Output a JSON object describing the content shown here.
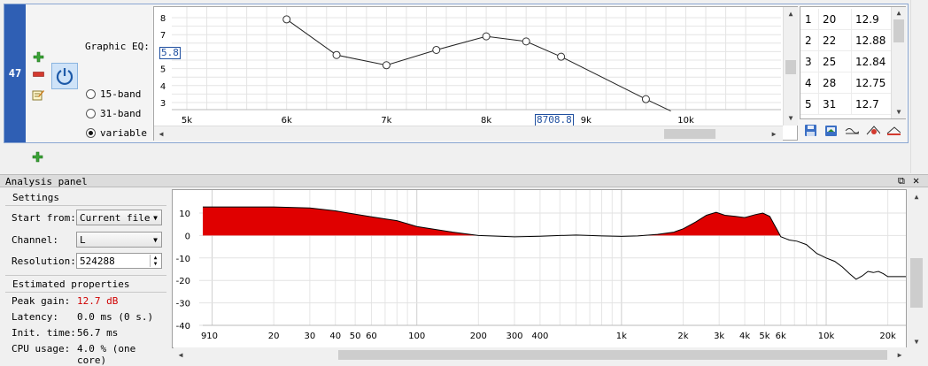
{
  "filter": {
    "index": "47",
    "graphic_eq_label": "Graphic EQ:",
    "eq_value_box": "5.8",
    "freq_value_box": "8708.8",
    "modes": [
      {
        "label": "15-band",
        "selected": false
      },
      {
        "label": "31-band",
        "selected": false
      },
      {
        "label": "variable",
        "selected": true
      }
    ],
    "y_ticks": [
      "8",
      "7",
      "6",
      "5",
      "4",
      "3"
    ],
    "x_ticks": [
      "5k",
      "6k",
      "7k",
      "8k",
      "9k",
      "10k"
    ],
    "eq_curve": [
      {
        "freq": 6000,
        "gain": 7.9
      },
      {
        "freq": 6500,
        "gain": 5.8
      },
      {
        "freq": 7000,
        "gain": 5.2
      },
      {
        "freq": 7500,
        "gain": 6.1
      },
      {
        "freq": 8000,
        "gain": 6.9
      },
      {
        "freq": 8400,
        "gain": 6.6
      },
      {
        "freq": 8750,
        "gain": 5.7
      },
      {
        "freq": 9600,
        "gain": 3.2
      },
      {
        "freq": 9850,
        "gain": 2.5
      }
    ],
    "table": [
      {
        "n": "1",
        "freq": "20",
        "gain": "12.9"
      },
      {
        "n": "2",
        "freq": "22",
        "gain": "12.88"
      },
      {
        "n": "3",
        "freq": "25",
        "gain": "12.84"
      },
      {
        "n": "4",
        "freq": "28",
        "gain": "12.75"
      },
      {
        "n": "5",
        "freq": "31",
        "gain": "12.7"
      }
    ],
    "colors": {
      "accent": "#2f5fb4",
      "add": "#3aa336",
      "remove": "#d33a2f"
    }
  },
  "analysis": {
    "title": "Analysis panel",
    "settings_heading": "Settings",
    "start_from_label": "Start from:",
    "start_from_value": "Current file",
    "channel_label": "Channel:",
    "channel_value": "L",
    "resolution_label": "Resolution:",
    "resolution_value": "524288",
    "estimated_heading": "Estimated properties",
    "peak_gain_label": "Peak gain:",
    "peak_gain_value": "12.7 dB",
    "latency_label": "Latency:",
    "latency_value": "0.0 ms (0 s.)",
    "init_time_label": "Init. time:",
    "init_time_value": "56.7 ms",
    "cpu_label": "CPU usage:",
    "cpu_value": "4.0 % (one core)",
    "peak_color": "#d00000"
  },
  "chart_data": {
    "type": "area",
    "title": "",
    "xlabel": "",
    "ylabel": "",
    "x_scale": "log",
    "xlim": [
      9,
      25000
    ],
    "ylim": [
      -40,
      15
    ],
    "y_ticks": [
      10,
      0,
      -10,
      -20,
      -30,
      -40
    ],
    "x_ticks": [
      {
        "v": 9,
        "label": "9"
      },
      {
        "v": 10,
        "label": "10"
      },
      {
        "v": 20,
        "label": "20"
      },
      {
        "v": 30,
        "label": "30"
      },
      {
        "v": 40,
        "label": "40"
      },
      {
        "v": 50,
        "label": "50"
      },
      {
        "v": 60,
        "label": "60"
      },
      {
        "v": 100,
        "label": "100"
      },
      {
        "v": 200,
        "label": "200"
      },
      {
        "v": 300,
        "label": "300"
      },
      {
        "v": 400,
        "label": "400"
      },
      {
        "v": 1000,
        "label": "1k"
      },
      {
        "v": 2000,
        "label": "2k"
      },
      {
        "v": 3000,
        "label": "3k"
      },
      {
        "v": 4000,
        "label": "4k"
      },
      {
        "v": 5000,
        "label": "5k"
      },
      {
        "v": 6000,
        "label": "6k"
      },
      {
        "v": 10000,
        "label": "10k"
      },
      {
        "v": 20000,
        "label": "20k"
      }
    ],
    "fill_color": "#e00000",
    "points": [
      [
        9,
        12.7
      ],
      [
        10,
        12.7
      ],
      [
        20,
        12.7
      ],
      [
        30,
        12.3
      ],
      [
        40,
        11.0
      ],
      [
        50,
        9.5
      ],
      [
        60,
        8.3
      ],
      [
        70,
        7.4
      ],
      [
        80,
        6.6
      ],
      [
        100,
        4.0
      ],
      [
        150,
        1.5
      ],
      [
        200,
        0.0
      ],
      [
        300,
        -0.6
      ],
      [
        400,
        -0.3
      ],
      [
        500,
        0.0
      ],
      [
        600,
        0.2
      ],
      [
        700,
        0.0
      ],
      [
        800,
        -0.2
      ],
      [
        1000,
        -0.4
      ],
      [
        1200,
        -0.2
      ],
      [
        1500,
        0.5
      ],
      [
        1800,
        1.5
      ],
      [
        2000,
        3.0
      ],
      [
        2300,
        6.0
      ],
      [
        2600,
        9.0
      ],
      [
        2900,
        10.3
      ],
      [
        3200,
        9.0
      ],
      [
        3600,
        8.5
      ],
      [
        4000,
        8.0
      ],
      [
        4500,
        9.3
      ],
      [
        4900,
        10.0
      ],
      [
        5300,
        8.5
      ],
      [
        5800,
        2.0
      ],
      [
        6000,
        -0.5
      ],
      [
        6600,
        -2.0
      ],
      [
        7200,
        -2.5
      ],
      [
        8000,
        -4.0
      ],
      [
        9000,
        -8.0
      ],
      [
        10000,
        -10.0
      ],
      [
        11000,
        -11.5
      ],
      [
        12000,
        -14.0
      ],
      [
        13000,
        -17.0
      ],
      [
        14000,
        -19.5
      ],
      [
        15000,
        -18.0
      ],
      [
        16000,
        -16.0
      ],
      [
        17000,
        -16.5
      ],
      [
        18000,
        -16.0
      ],
      [
        19000,
        -17.0
      ],
      [
        20000,
        -18.3
      ],
      [
        22000,
        -18.3
      ],
      [
        25000,
        -18.3
      ]
    ]
  }
}
